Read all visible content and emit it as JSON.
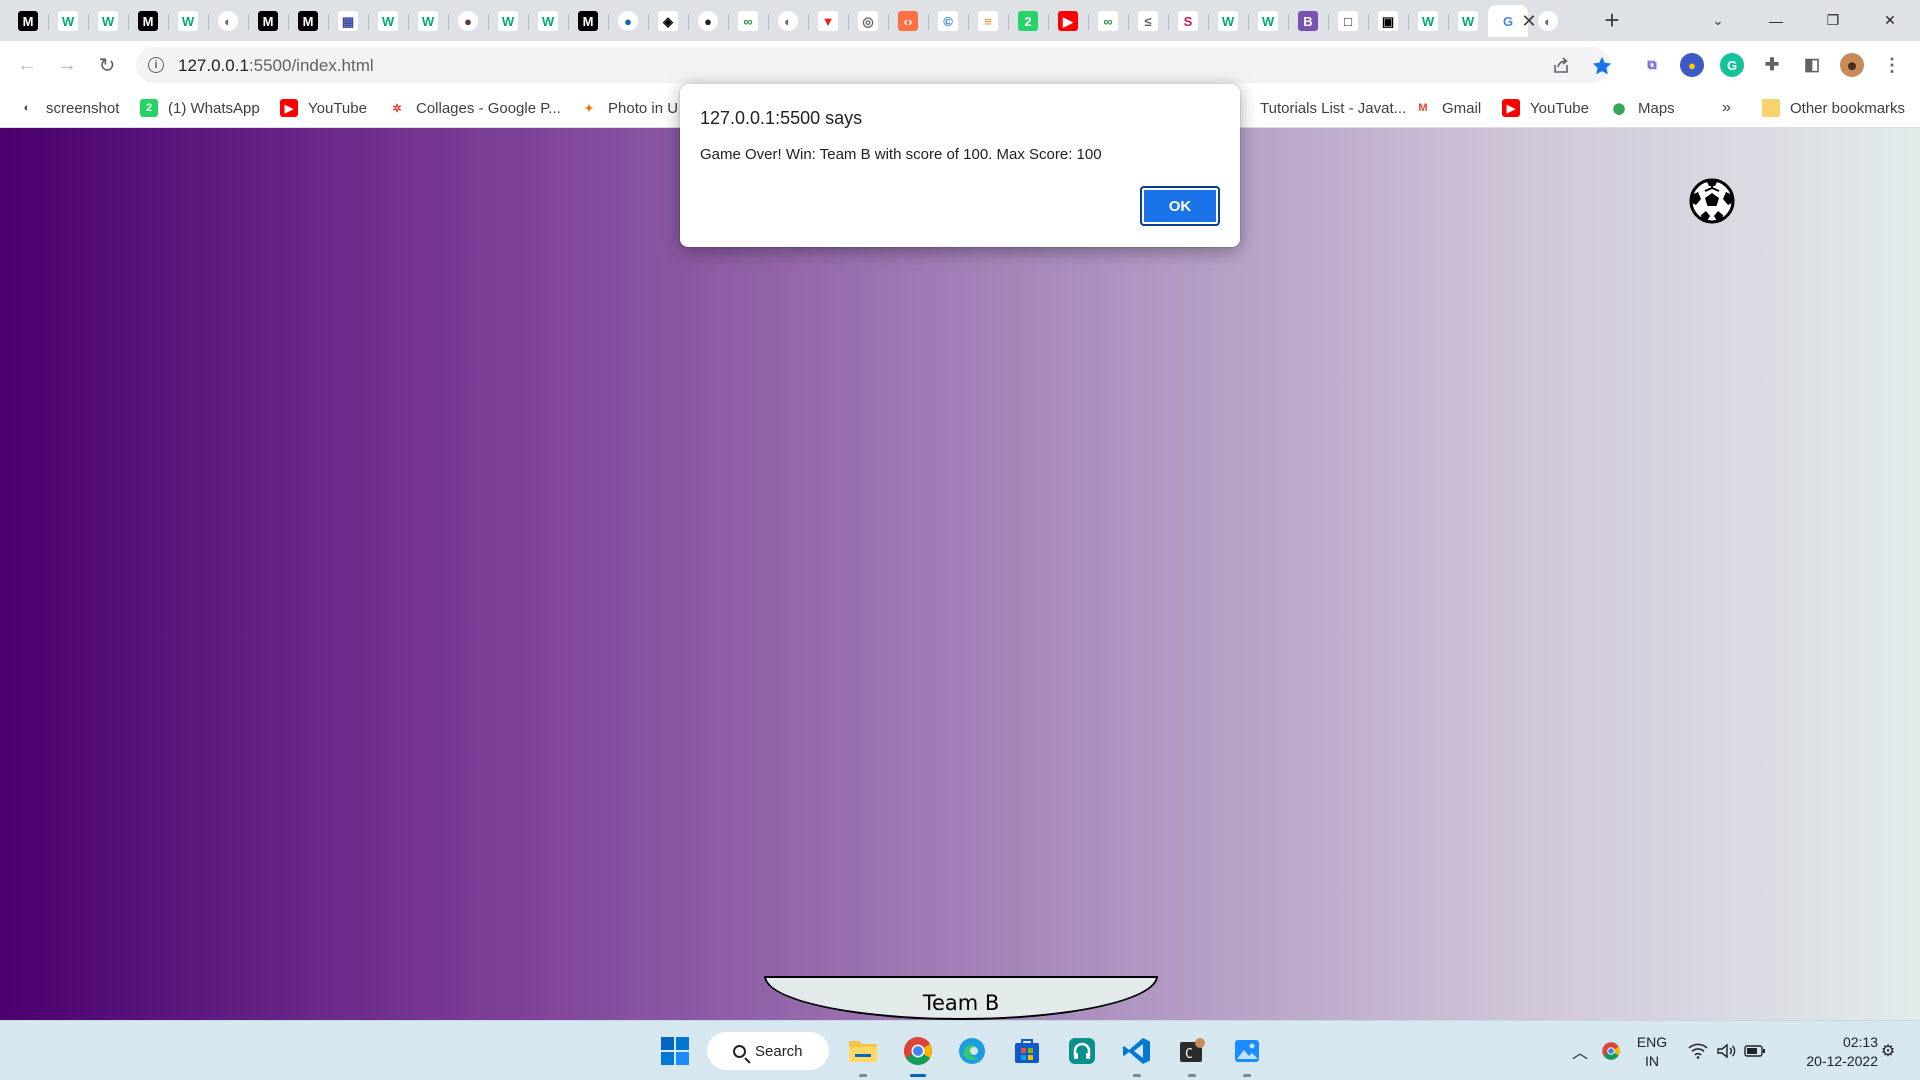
{
  "browser": {
    "tabs": [
      {
        "icon": "medium-icon",
        "glyph": "M",
        "bg": "#000000",
        "fg": "#ffffff"
      },
      {
        "icon": "w3schools-icon",
        "glyph": "W",
        "bg": "#ffffff",
        "fg": "#04aa6d"
      },
      {
        "icon": "w3schools-icon",
        "glyph": "W",
        "bg": "#ffffff",
        "fg": "#04aa6d"
      },
      {
        "icon": "medium-icon",
        "glyph": "M",
        "bg": "#000000",
        "fg": "#ffffff"
      },
      {
        "icon": "w3schools-icon",
        "glyph": "W",
        "bg": "#ffffff",
        "fg": "#04aa6d"
      },
      {
        "icon": "globe-icon",
        "glyph": "◐",
        "bg": "#ffffff",
        "fg": "#5f6368"
      },
      {
        "icon": "medium-icon",
        "glyph": "M",
        "bg": "#000000",
        "fg": "#ffffff"
      },
      {
        "icon": "medium-icon",
        "glyph": "M",
        "bg": "#000000",
        "fg": "#ffffff"
      },
      {
        "icon": "calculator-icon",
        "glyph": "▦",
        "bg": "#ffffff",
        "fg": "#3c4aa0"
      },
      {
        "icon": "w3schools-icon",
        "glyph": "W",
        "bg": "#ffffff",
        "fg": "#04aa6d"
      },
      {
        "icon": "w3schools-icon",
        "glyph": "W",
        "bg": "#ffffff",
        "fg": "#04aa6d"
      },
      {
        "icon": "avatar-icon",
        "glyph": "●",
        "bg": "#ffffff",
        "fg": "#5a3a2a"
      },
      {
        "icon": "w3schools-icon",
        "glyph": "W",
        "bg": "#ffffff",
        "fg": "#04aa6d"
      },
      {
        "icon": "w3schools-icon",
        "glyph": "W",
        "bg": "#ffffff",
        "fg": "#04aa6d"
      },
      {
        "icon": "medium-icon",
        "glyph": "M",
        "bg": "#000000",
        "fg": "#ffffff"
      },
      {
        "icon": "globe-blue-icon",
        "glyph": "●",
        "bg": "#ffffff",
        "fg": "#1a5fb4"
      },
      {
        "icon": "codepen-icon",
        "glyph": "◈",
        "bg": "#ffffff",
        "fg": "#000000"
      },
      {
        "icon": "github-icon",
        "glyph": "●",
        "bg": "#ffffff",
        "fg": "#202124"
      },
      {
        "icon": "geeksforgeeks-icon",
        "glyph": "∞",
        "bg": "#ffffff",
        "fg": "#2f8d46"
      },
      {
        "icon": "globe-icon",
        "glyph": "◐",
        "bg": "#ffffff",
        "fg": "#5f6368"
      },
      {
        "icon": "vercel-icon",
        "glyph": "▼",
        "bg": "#ffffff",
        "fg": "#e0261b"
      },
      {
        "icon": "chrome-gray-icon",
        "glyph": "◎",
        "bg": "#ffffff",
        "fg": "#5f6368"
      },
      {
        "icon": "hackerrank-icon",
        "glyph": "‹›",
        "bg": "#ff7043",
        "fg": "#ffffff"
      },
      {
        "icon": "copyright-icon",
        "glyph": "©",
        "bg": "#ffffff",
        "fg": "#1a73e8"
      },
      {
        "icon": "stackoverflow-icon",
        "glyph": "≡",
        "bg": "#ffffff",
        "fg": "#f48024"
      },
      {
        "icon": "green-2-icon",
        "glyph": "2",
        "bg": "#25d366",
        "fg": "#ffffff"
      },
      {
        "icon": "youtube-icon",
        "glyph": "▶",
        "bg": "#ff0000",
        "fg": "#ffffff"
      },
      {
        "icon": "geeksforgeeks-icon",
        "glyph": "∞",
        "bg": "#ffffff",
        "fg": "#2f8d46"
      },
      {
        "icon": "leetcode-icon",
        "glyph": "≤",
        "bg": "#ffffff",
        "fg": "#5f6368"
      },
      {
        "icon": "gradient-swirl-icon",
        "glyph": "S",
        "bg": "#ffffff",
        "fg": "#c2185b"
      },
      {
        "icon": "w3schools-icon",
        "glyph": "W",
        "bg": "#ffffff",
        "fg": "#04aa6d"
      },
      {
        "icon": "w3schools-icon",
        "glyph": "W",
        "bg": "#ffffff",
        "fg": "#04aa6d"
      },
      {
        "icon": "bootstrap-icon",
        "glyph": "B",
        "bg": "#7952b3",
        "fg": "#ffffff"
      },
      {
        "icon": "square-icon",
        "glyph": "□",
        "bg": "#ffffff",
        "fg": "#202124"
      },
      {
        "icon": "square-black-icon",
        "glyph": "▣",
        "bg": "#ffffff",
        "fg": "#000000"
      },
      {
        "icon": "w3schools-icon",
        "glyph": "W",
        "bg": "#ffffff",
        "fg": "#04aa6d"
      },
      {
        "icon": "w3schools-icon",
        "glyph": "W",
        "bg": "#ffffff",
        "fg": "#04aa6d"
      },
      {
        "icon": "google-icon",
        "glyph": "G",
        "bg": "#ffffff",
        "fg": "#4285f4",
        "active": true
      },
      {
        "icon": "globe-icon",
        "glyph": "◐",
        "bg": "#ffffff",
        "fg": "#5f6368"
      }
    ],
    "close_tab_glyph": "✕",
    "new_tab_glyph": "+",
    "tab_search_glyph": "⌄",
    "window_controls": {
      "minimize": "—",
      "restore": "❐",
      "close": "✕"
    },
    "toolbar": {
      "back_glyph": "←",
      "forward_glyph": "→",
      "reload_glyph": "↻",
      "url_host": "127.0.0.1",
      "url_rest": ":5500/index.html"
    },
    "bookmarks": [
      {
        "label": "screenshot",
        "icon": "globe-icon",
        "glyph": "◐",
        "bg": "#ffffff",
        "fg": "#3c4043"
      },
      {
        "label": "(1) WhatsApp",
        "icon": "whatsapp-icon",
        "glyph": "2",
        "bg": "#25d366",
        "fg": "#ffffff"
      },
      {
        "label": "YouTube",
        "icon": "youtube-icon",
        "glyph": "▶",
        "bg": "#ff0000",
        "fg": "#ffffff"
      },
      {
        "label": "Collages - Google P...",
        "icon": "google-photos-icon",
        "glyph": "✲",
        "bg": "#ffffff",
        "fg": "#ea4335"
      },
      {
        "label": "Photo in U",
        "icon": "pinwheel-icon",
        "glyph": "✦",
        "bg": "#ffffff",
        "fg": "#e37400"
      },
      {
        "label": "Tutorials List - Javat...",
        "icon": "javatpoint-icon",
        "glyph": "",
        "bg": "#ffffff",
        "fg": "#c00000"
      },
      {
        "label": "Gmail",
        "icon": "gmail-icon",
        "glyph": "M",
        "bg": "#ffffff",
        "fg": "#ea4335"
      },
      {
        "label": "YouTube",
        "icon": "youtube-icon",
        "glyph": "▶",
        "bg": "#ff0000",
        "fg": "#ffffff"
      },
      {
        "label": "Maps",
        "icon": "maps-pin-icon",
        "glyph": "⬤",
        "bg": "#ffffff",
        "fg": "#34a853"
      }
    ],
    "bookmarks_overflow": "»",
    "other_bookmarks": "Other bookmarks"
  },
  "dialog": {
    "origin": "127.0.0.1:5500 says",
    "message": "Game Over! Win: Team B with score of 100. Max Score: 100",
    "ok_label": "OK"
  },
  "game": {
    "paddle_label": "Team B",
    "background_start": "#4b006e",
    "background_end": "#e2ebea"
  },
  "taskbar": {
    "search_label": "Search",
    "language_line1": "ENG",
    "language_line2": "IN",
    "time": "02:13",
    "date": "20-12-2022"
  }
}
